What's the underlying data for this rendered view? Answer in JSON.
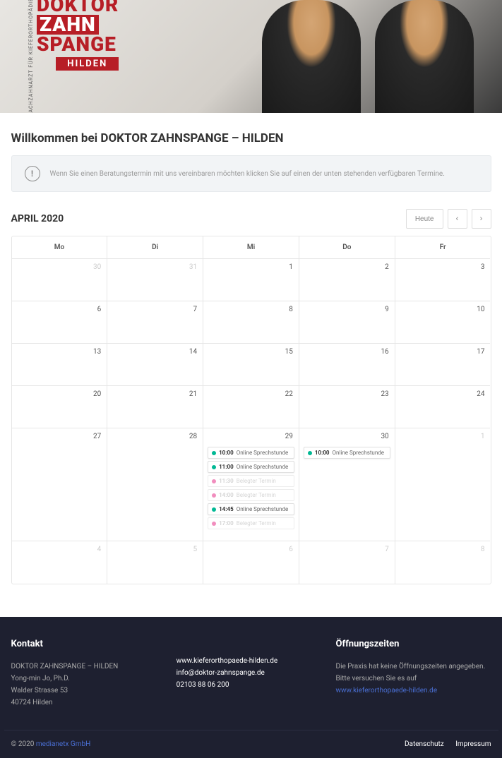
{
  "logo": {
    "rotated": "FACHZAHNARZT FÜR KIEFERORTHOPÄDIE",
    "line1": "DOKTOR",
    "line2": "ZAHN",
    "line3": "SPANGE",
    "badge": "HILDEN"
  },
  "page_title": "Willkommen bei DOKTOR ZAHNSPANGE – HILDEN",
  "info_text": "Wenn Sie einen Beratungstermin mit uns vereinbaren möchten klicken Sie auf einen der unten stehenden verfügbaren Termine.",
  "calendar": {
    "title": "APRIL 2020",
    "today_label": "Heute",
    "weekdays": [
      "Mo",
      "Di",
      "Mi",
      "Do",
      "Fr"
    ],
    "rows": [
      [
        {
          "d": "30",
          "muted": true
        },
        {
          "d": "31",
          "muted": true
        },
        {
          "d": "1"
        },
        {
          "d": "2"
        },
        {
          "d": "3"
        }
      ],
      [
        {
          "d": "6"
        },
        {
          "d": "7"
        },
        {
          "d": "8"
        },
        {
          "d": "9"
        },
        {
          "d": "10"
        }
      ],
      [
        {
          "d": "13"
        },
        {
          "d": "14"
        },
        {
          "d": "15"
        },
        {
          "d": "16"
        },
        {
          "d": "17"
        }
      ],
      [
        {
          "d": "20"
        },
        {
          "d": "21"
        },
        {
          "d": "22"
        },
        {
          "d": "23"
        },
        {
          "d": "24"
        }
      ],
      [
        {
          "d": "27"
        },
        {
          "d": "28"
        },
        {
          "d": "29",
          "events": [
            {
              "time": "10:00",
              "label": "Online Sprechstunde",
              "status": "open"
            },
            {
              "time": "11:00",
              "label": "Online Sprechstunde",
              "status": "open"
            },
            {
              "time": "11:30",
              "label": "Belegter Termin",
              "status": "booked"
            },
            {
              "time": "14:00",
              "label": "Belegter Termin",
              "status": "booked"
            },
            {
              "time": "14:45",
              "label": "Online Sprechstunde",
              "status": "open"
            },
            {
              "time": "17:00",
              "label": "Belegter Termin",
              "status": "booked"
            }
          ]
        },
        {
          "d": "30",
          "events": [
            {
              "time": "10:00",
              "label": "Online Sprechstunde",
              "status": "open"
            }
          ]
        },
        {
          "d": "1",
          "muted": true
        }
      ],
      [
        {
          "d": "4",
          "muted": true
        },
        {
          "d": "5",
          "muted": true
        },
        {
          "d": "6",
          "muted": true
        },
        {
          "d": "7",
          "muted": true
        },
        {
          "d": "8",
          "muted": true
        }
      ]
    ]
  },
  "footer": {
    "contact_heading": "Kontakt",
    "practice": "DOKTOR ZAHNSPANGE – HILDEN",
    "doctor": "Yong-min Jo, Ph.D.",
    "street": "Walder Strasse 53",
    "city": "40724 Hilden",
    "website": "www.kieferorthopaede-hilden.de",
    "email": "info@doktor-zahnspange.de",
    "phone": "02103 88 06 200",
    "hours_heading": "Öffnungszeiten",
    "hours_text": "Die Praxis hat keine Öffnungszeiten angegeben. Bitte versuchen Sie es auf ",
    "hours_link": "www.kieferorthopaede-hilden.de",
    "copyright_prefix": "© 2020 ",
    "copyright_link": "medianetx GmbH",
    "privacy": "Datenschutz",
    "imprint": "Impressum"
  }
}
